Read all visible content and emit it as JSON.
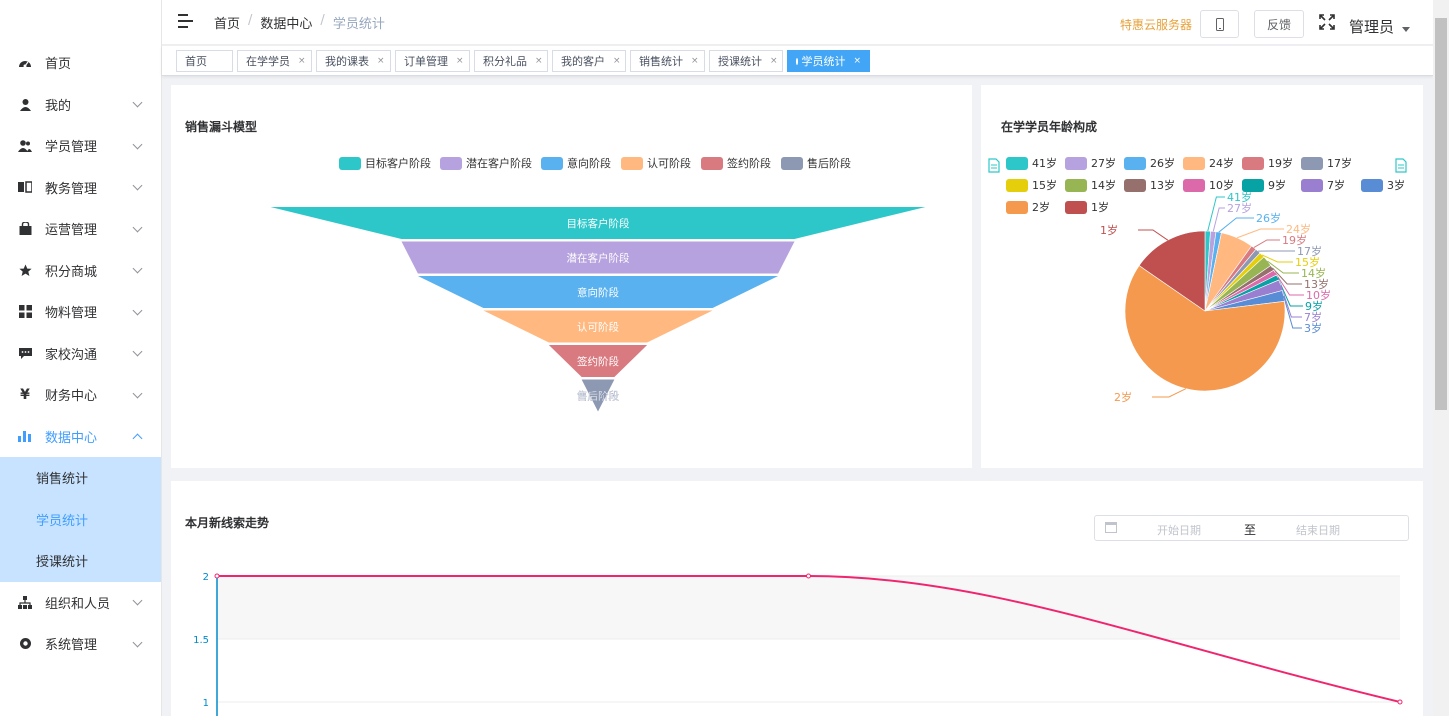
{
  "sidebar": {
    "items": [
      {
        "label": "首页",
        "icon": "dashboard-icon",
        "arrow": false
      },
      {
        "label": "我的",
        "icon": "user-icon",
        "arrow": true
      },
      {
        "label": "学员管理",
        "icon": "users-icon",
        "arrow": true
      },
      {
        "label": "教务管理",
        "icon": "book-icon",
        "arrow": true
      },
      {
        "label": "运营管理",
        "icon": "bag-icon",
        "arrow": true
      },
      {
        "label": "积分商城",
        "icon": "star-icon",
        "arrow": true
      },
      {
        "label": "物料管理",
        "icon": "grid-icon",
        "arrow": true
      },
      {
        "label": "家校沟通",
        "icon": "chat-icon",
        "arrow": true
      },
      {
        "label": "财务中心",
        "icon": "yen-icon",
        "arrow": true
      },
      {
        "label": "数据中心",
        "icon": "bar-chart-icon",
        "arrow": true,
        "open": true
      },
      {
        "label": "组织和人员",
        "icon": "org-icon",
        "arrow": true
      },
      {
        "label": "系统管理",
        "icon": "settings-icon",
        "arrow": true
      }
    ],
    "submenu": [
      {
        "label": "销售统计",
        "active": false
      },
      {
        "label": "学员统计",
        "active": true
      },
      {
        "label": "授课统计",
        "active": false
      }
    ]
  },
  "header": {
    "breadcrumb": [
      "首页",
      "数据中心",
      "学员统计"
    ],
    "promo": "特惠云服务器",
    "feedback": "反馈",
    "user": "管理员"
  },
  "tags": [
    {
      "label": "首页",
      "closable": false
    },
    {
      "label": "在学学员",
      "closable": true
    },
    {
      "label": "我的课表",
      "closable": true
    },
    {
      "label": "订单管理",
      "closable": true
    },
    {
      "label": "积分礼品",
      "closable": true
    },
    {
      "label": "我的客户",
      "closable": true
    },
    {
      "label": "销售统计",
      "closable": true
    },
    {
      "label": "授课统计",
      "closable": true
    },
    {
      "label": "学员统计",
      "closable": true,
      "active": true
    }
  ],
  "colors": {
    "accent": "#409eff",
    "promo": "#e6a23c",
    "line": "#f0256f"
  },
  "chart_data": [
    {
      "type": "funnel",
      "title": "销售漏斗模型",
      "legend_position": "top",
      "categories": [
        "目标客户阶段",
        "潜在客户阶段",
        "意向阶段",
        "认可阶段",
        "签约阶段",
        "售后阶段"
      ],
      "values": [
        100,
        60,
        55,
        35,
        15,
        5
      ],
      "colors": [
        "#2ec7c9",
        "#b6a2de",
        "#5ab1ef",
        "#ffb980",
        "#d87a80",
        "#8d98b3"
      ]
    },
    {
      "type": "pie",
      "title": "在学学员年龄构成",
      "legend_position": "top",
      "categories": [
        "41岁",
        "27岁",
        "26岁",
        "24岁",
        "19岁",
        "17岁",
        "15岁",
        "14岁",
        "13岁",
        "10岁",
        "9岁",
        "7岁",
        "3岁",
        "2岁",
        "1岁"
      ],
      "values": [
        1,
        1,
        1,
        6,
        1,
        1,
        1,
        2,
        1,
        1,
        1,
        2,
        2,
        56,
        14
      ],
      "colors": [
        "#2ec7c9",
        "#b6a2de",
        "#5ab1ef",
        "#ffb980",
        "#d87a80",
        "#8d98b3",
        "#e5cf0d",
        "#97b552",
        "#95706d",
        "#dc69aa",
        "#07a2a4",
        "#9a7fd1",
        "#588dd5",
        "#f5994e",
        "#c05050"
      ]
    },
    {
      "type": "line",
      "title": "本月新线索走势",
      "yticks": [
        "2",
        "1.5",
        "1"
      ],
      "ylim": [
        1,
        2
      ],
      "x": [
        0,
        1,
        2
      ],
      "values": [
        2,
        2,
        1
      ],
      "smooth": true,
      "date_range": {
        "start_placeholder": "开始日期",
        "separator": "至",
        "end_placeholder": "结束日期"
      }
    }
  ]
}
